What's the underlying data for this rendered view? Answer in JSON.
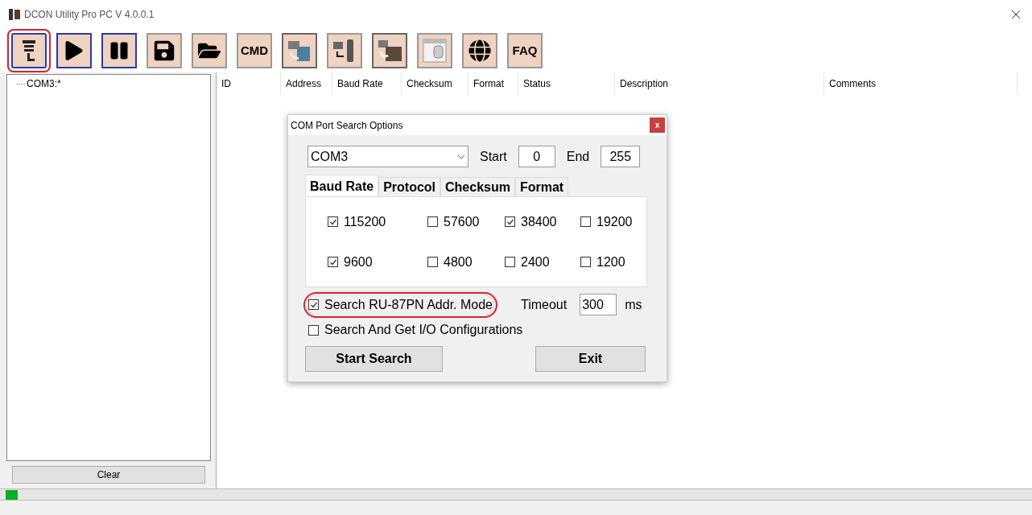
{
  "window": {
    "title": "DCON Utility Pro PC V 4.0.0.1"
  },
  "toolbar": [
    {
      "kind": "icon",
      "highlighted": true
    },
    {
      "kind": "icon",
      "highlighted": false
    },
    {
      "kind": "icon",
      "highlighted": false
    },
    {
      "kind": "icon",
      "highlighted": false
    },
    {
      "kind": "icon",
      "highlighted": false
    },
    {
      "kind": "text",
      "label": "CMD",
      "highlighted": false
    },
    {
      "kind": "icon",
      "highlighted": false
    },
    {
      "kind": "icon",
      "highlighted": false
    },
    {
      "kind": "icon",
      "highlighted": false
    },
    {
      "kind": "icon",
      "highlighted": false
    },
    {
      "kind": "icon",
      "highlighted": false
    },
    {
      "kind": "text",
      "label": "FAQ",
      "highlighted": false
    }
  ],
  "tree": {
    "items": [
      {
        "label": "COM3:*"
      }
    ]
  },
  "clear_button": "Clear",
  "table": {
    "columns": [
      "ID",
      "Address",
      "Baud Rate",
      "Checksum",
      "Format",
      "Status",
      "Description",
      "Comments"
    ]
  },
  "progress": {
    "level": 0.012
  },
  "dialog": {
    "title": "COM Port Search Options",
    "close": "x",
    "port": "COM3",
    "start_label": "Start",
    "start": "0",
    "end_label": "End",
    "end": "255",
    "tabs": [
      {
        "label": "Baud Rate",
        "selected": true
      },
      {
        "label": "Protocol",
        "selected": false
      },
      {
        "label": "Checksum",
        "selected": false
      },
      {
        "label": "Format",
        "selected": false
      }
    ],
    "baud_rates": [
      {
        "label": "115200",
        "checked": true
      },
      {
        "label": "57600",
        "checked": false
      },
      {
        "label": "38400",
        "checked": true
      },
      {
        "label": "19200",
        "checked": false
      },
      {
        "label": "9600",
        "checked": true
      },
      {
        "label": "4800",
        "checked": false
      },
      {
        "label": "2400",
        "checked": false
      },
      {
        "label": "1200",
        "checked": false
      }
    ],
    "options": [
      {
        "label": "Search RU-87PN Addr. Mode",
        "checked": true,
        "highlighted": true
      },
      {
        "label": "Search And Get I/O Configurations",
        "checked": false,
        "highlighted": false
      }
    ],
    "timeout_label": "Timeout",
    "timeout": "300",
    "timeout_unit": "ms",
    "buttons": [
      "Start Search",
      "Exit"
    ]
  }
}
